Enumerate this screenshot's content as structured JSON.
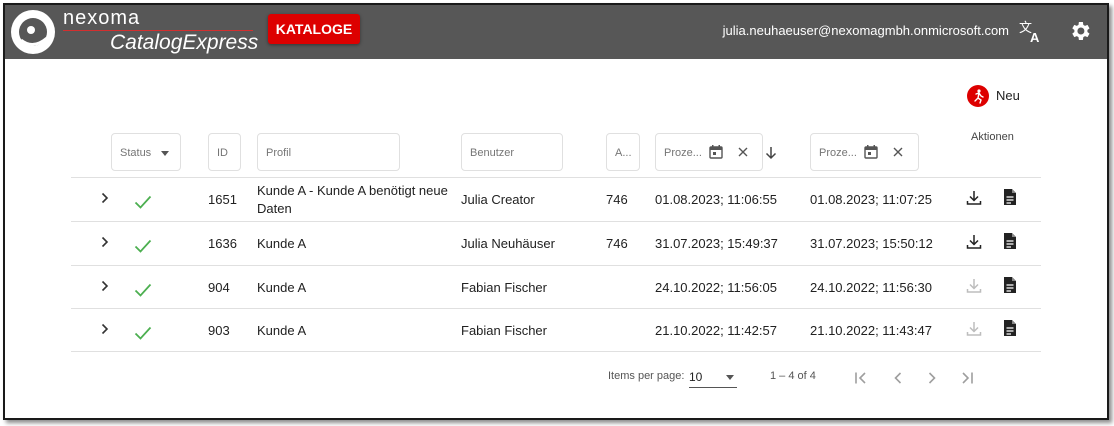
{
  "header": {
    "brand_name": "nexoma",
    "brand_product": "CatalogExpress",
    "nav_button": "KATALOGE",
    "user_email": "julia.neuhaeuser@nexomagmbh.onmicrosoft.com",
    "icons": {
      "translate": "translate-icon",
      "settings": "gear-icon"
    }
  },
  "toolbar": {
    "new_label": "Neu",
    "actions_header": "Aktionen"
  },
  "filters": {
    "status": "Status",
    "id": "ID",
    "profil": "Profil",
    "benutzer": "Benutzer",
    "anzahl": "A...",
    "prozess_start": "Proze...",
    "prozess_end": "Proze..."
  },
  "rows": [
    {
      "id": "1651",
      "profil_line1": "Kunde A - Kunde A benötigt neue",
      "profil_line2": "Daten",
      "benutzer": "Julia Creator",
      "anzahl": "746",
      "start": "01.08.2023; 11:06:55",
      "end": "01.08.2023; 11:07:25",
      "status": "done",
      "download_enabled": true
    },
    {
      "id": "1636",
      "profil_line1": "Kunde A",
      "profil_line2": "",
      "benutzer": "Julia Neuhäuser",
      "anzahl": "746",
      "start": "31.07.2023; 15:49:37",
      "end": "31.07.2023; 15:50:12",
      "status": "done",
      "download_enabled": true
    },
    {
      "id": "904",
      "profil_line1": "Kunde A",
      "profil_line2": "",
      "benutzer": "Fabian Fischer",
      "anzahl": "",
      "start": "24.10.2022; 11:56:05",
      "end": "24.10.2022; 11:56:30",
      "status": "done",
      "download_enabled": false
    },
    {
      "id": "903",
      "profil_line1": "Kunde A",
      "profil_line2": "",
      "benutzer": "Fabian Fischer",
      "anzahl": "",
      "start": "21.10.2022; 11:42:57",
      "end": "21.10.2022; 11:43:47",
      "status": "done",
      "download_enabled": false
    }
  ],
  "paginator": {
    "items_per_page_label": "Items per page:",
    "page_size": "10",
    "range_label": "1 – 4 of 4"
  },
  "colors": {
    "topbar": "#575757",
    "accent": "#dd0000",
    "check": "#4caf50"
  }
}
